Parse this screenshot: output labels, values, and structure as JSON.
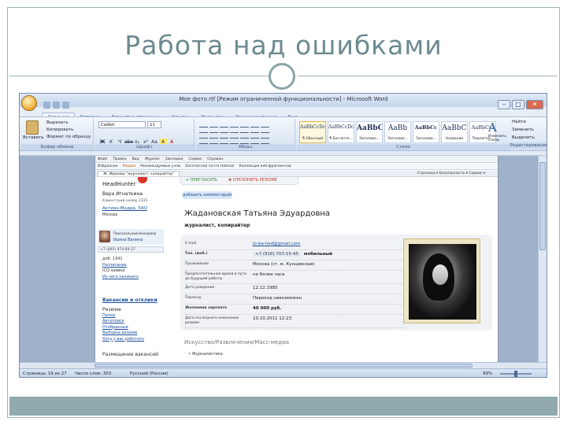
{
  "slide": {
    "title": "Работа над ошибками"
  },
  "word": {
    "window_title": "Мое фото.rtf [Режим ограниченной функциональности] - Microsoft Word",
    "window_buttons": [
      "–",
      "□",
      "✕"
    ],
    "tabs": [
      "Главная",
      "Вставка",
      "Разметка страницы",
      "Ссылки",
      "Рассылки",
      "Рецензирование",
      "Вид"
    ],
    "clipboard": {
      "paste_label": "Вставить",
      "cut": "Вырезать",
      "copy": "Копировать",
      "format_painter": "Формат по образцу",
      "group_label": "Буфер обмена"
    },
    "font": {
      "name": "Calibri",
      "size": "11",
      "format_buttons": [
        "Ж",
        "К",
        "Ч",
        "abe",
        "x₂",
        "x²",
        "Aa",
        "A",
        "A"
      ],
      "group_label": "Шрифт"
    },
    "paragraph": {
      "group_label": "Абзац"
    },
    "styles": {
      "items": [
        {
          "sample": "AaBbCcDc",
          "name": "¶ Обычный"
        },
        {
          "sample": "AaBbCcDc",
          "name": "¶ Без инте..."
        },
        {
          "sample": "AaBbC",
          "name": "Заголово..."
        },
        {
          "sample": "AaBb",
          "name": "Заголово..."
        },
        {
          "sample": "AaBbCc",
          "name": "Заголово..."
        },
        {
          "sample": "AaBbC",
          "name": "Название"
        },
        {
          "sample": "AaBbCcI",
          "name": "Подзагол..."
        }
      ],
      "group_label": "Стили",
      "change_styles": "Изменить стили"
    },
    "editing": {
      "find": "Найти",
      "replace": "Заменить",
      "select": "Выделить",
      "group_label": "Редактирование"
    },
    "status": {
      "page": "Страница: 19 из 27",
      "words": "Число слов: 303",
      "language": "Русский (Россия)",
      "zoom": "99%"
    }
  },
  "browser": {
    "toolbar_items": [
      "Файл",
      "Правка",
      "Вид",
      "Журнал",
      "Закладки",
      "Сервис",
      "Справка"
    ],
    "favorites": [
      {
        "label": "Избранное",
        "tone": "normal"
      },
      {
        "label": "Раздел",
        "tone": "orange"
      },
      {
        "label": "Рекомендуемые узлы",
        "tone": "normal"
      },
      {
        "label": "Бесплатная почта Hotmail",
        "tone": "normal"
      },
      {
        "label": "Коллекция веб-фрагментов",
        "tone": "normal"
      }
    ],
    "active_tab": "Ж. Иванова \"журналист, копирайтер\"",
    "page_tools": "Страница ▾   Безопасность ▾   Сервис ▾"
  },
  "hh": {
    "logo": "HeadHunter",
    "invite": "✔ ПРИГЛАСИТЬ",
    "reject": "✖ ОТКЛОНИТЬ РЕЗЮМЕ",
    "add_comment": "добавить комментарий",
    "employer": {
      "name": "Вера Игнаткина",
      "phone_note": "Клиентский номер 2335",
      "company": "Актион-Медиа, ЗАО",
      "city": "Москва"
    },
    "manager": {
      "role": "Персональный менеджер",
      "name": "Ирина Ванина"
    },
    "manager_phone": "+7 (495) 974-69-27",
    "manager_links": [
      {
        "text": "доб. 1341",
        "kind": "text"
      },
      {
        "text": "Расписание",
        "kind": "link"
      },
      {
        "text": "ICQ заявки",
        "kind": "text"
      },
      {
        "text": "Из чего начинать",
        "kind": "link"
      }
    ],
    "nav_head": "Вакансии и отклики",
    "nav_items": [
      {
        "text": "Резюме",
        "kind": "title"
      },
      {
        "text": "Папки",
        "kind": "link"
      },
      {
        "text": "Автопоиск",
        "kind": "link"
      },
      {
        "text": "Отобранные",
        "kind": "link"
      },
      {
        "text": "Выборка резюме",
        "kind": "link"
      },
      {
        "text": "Хочу у вас работать",
        "kind": "link"
      }
    ],
    "nav_post": "Размещение вакансий",
    "candidate": {
      "name": "Жаданoвская Татьяна Эдуардовна",
      "title": "журналист, копирайтер"
    },
    "details": [
      {
        "label": "E-mail",
        "value": "jo-ba-hed@gmail.com",
        "kind": "link"
      },
      {
        "label": "Тел. (моб.)",
        "value": "+7 (916) 707-15-45",
        "extra": "мобильный",
        "kind": "phone"
      },
      {
        "label": "Проживание",
        "value": "Москва (ст. м. Кунцевская)",
        "kind": "text"
      },
      {
        "label": "Предпочтительное время в пути до будущей работы",
        "value": "не более часа",
        "kind": "text"
      },
      {
        "label": "Дата рождения",
        "value": "12.12.1985",
        "kind": "text"
      },
      {
        "label": "Переезд",
        "value": "Переезд невозможен",
        "kind": "text"
      },
      {
        "label": "Желаемая зарплата",
        "value": "40 000 руб.",
        "kind": "bold"
      },
      {
        "label": "Дата последнего изменения резюме",
        "value": "10.10.2011 12:23",
        "kind": "text"
      }
    ],
    "category": "Искусство/Развлечения/Масс-медиа",
    "sub_category": "• Журналистика"
  }
}
